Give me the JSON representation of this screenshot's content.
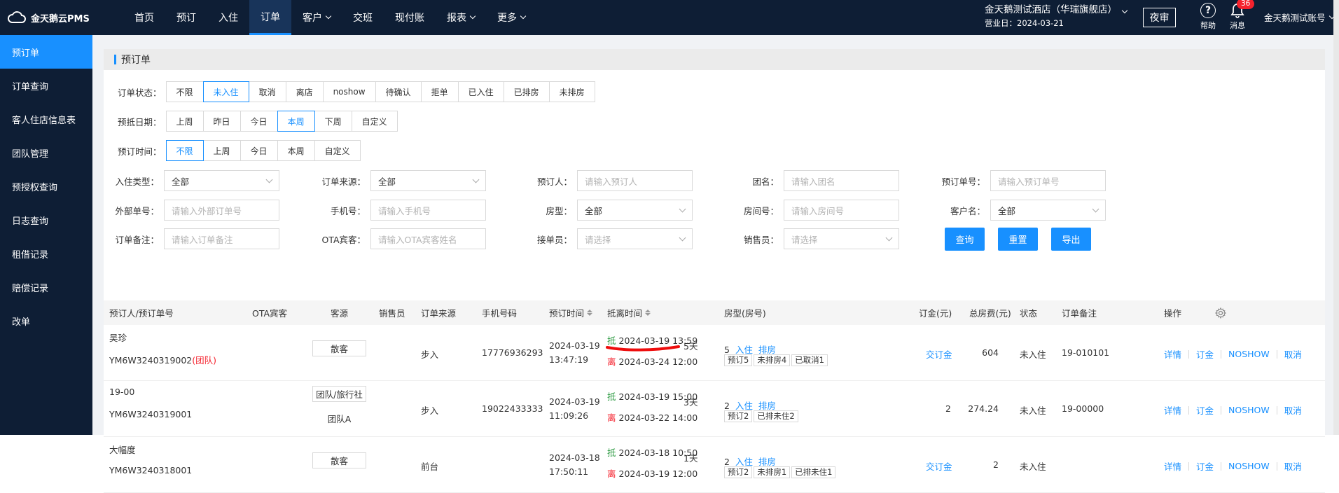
{
  "app": {
    "logo_text": "金天鹅云PMS"
  },
  "nav": [
    {
      "label": "首页",
      "caret": false
    },
    {
      "label": "预订",
      "caret": false
    },
    {
      "label": "入住",
      "caret": false
    },
    {
      "label": "订单",
      "caret": false,
      "active": true
    },
    {
      "label": "客户",
      "caret": true
    },
    {
      "label": "交班",
      "caret": false
    },
    {
      "label": "现付账",
      "caret": false
    },
    {
      "label": "报表",
      "caret": true
    },
    {
      "label": "更多",
      "caret": true
    }
  ],
  "header": {
    "hotel_name": "金天鹅测试酒店（华瑞旗舰店）",
    "business_date": "营业日：2024-03-21",
    "night_audit": "夜审",
    "help": "帮助",
    "message": "消息",
    "message_count": "36",
    "account": "金天鹅测试账号"
  },
  "sidebar": [
    {
      "label": "预订单",
      "active": true
    },
    {
      "label": "订单查询"
    },
    {
      "label": "客人住店信息表"
    },
    {
      "label": "团队管理"
    },
    {
      "label": "预授权查询"
    },
    {
      "label": "日志查询"
    },
    {
      "label": "租借记录"
    },
    {
      "label": "赔偿记录"
    },
    {
      "label": "改单"
    }
  ],
  "page_title": "预订单",
  "filters": {
    "status_label": "订单状态：",
    "status_options": [
      "不限",
      "未入住",
      "取消",
      "离店",
      "noshow",
      "待确认",
      "拒单",
      "已入住",
      "已排房",
      "未排房"
    ],
    "status_selected": 1,
    "arrive_label": "预抵日期：",
    "arrive_options": [
      "上周",
      "昨日",
      "今日",
      "本周",
      "下周",
      "自定义"
    ],
    "arrive_selected": 3,
    "book_label": "预订时间：",
    "book_options": [
      "不限",
      "上周",
      "今日",
      "本周",
      "自定义"
    ],
    "book_selected": 0,
    "fields": {
      "checkin_type": {
        "label": "入住类型：",
        "value": "全部"
      },
      "order_source": {
        "label": "订单来源：",
        "value": "全部"
      },
      "booker": {
        "label": "预订人：",
        "placeholder": "请输入预订人"
      },
      "group_name": {
        "label": "团名：",
        "placeholder": "请输入团名"
      },
      "order_no": {
        "label": "预订单号：",
        "placeholder": "请输入预订单号"
      },
      "ext_order_no": {
        "label": "外部单号：",
        "placeholder": "请输入外部订单号"
      },
      "phone": {
        "label": "手机号：",
        "placeholder": "请输入手机号"
      },
      "room_type": {
        "label": "房型：",
        "value": "全部"
      },
      "room_no": {
        "label": "房间号：",
        "placeholder": "请输入房间号"
      },
      "customer": {
        "label": "客户名：",
        "value": "全部"
      },
      "remark": {
        "label": "订单备注：",
        "placeholder": "请输入订单备注"
      },
      "ota_guest": {
        "label": "OTA宾客：",
        "placeholder": "请输入OTA宾客姓名"
      },
      "receiver": {
        "label": "接单员：",
        "placeholder": "请选择"
      },
      "sales": {
        "label": "销售员：",
        "placeholder": "请选择"
      }
    },
    "query": "查询",
    "reset": "重置",
    "export": "导出"
  },
  "table": {
    "headers": [
      "预订人/预订单号",
      "OTA宾客",
      "客源",
      "销售员",
      "订单来源",
      "手机号码",
      "预订时间",
      "抵离时间",
      "房型(房号)",
      "订金(元)",
      "总房费(元)",
      "状态",
      "订单备注",
      "操作"
    ],
    "rows": [
      {
        "booker": "吴珍",
        "order_no": "YM6W3240319002",
        "group_tag": "(团队)",
        "source_tag": "散客",
        "source_sub": "",
        "channel": "步入",
        "phone": "17776936293",
        "book_date": "2024-03-19",
        "book_time": "13:47:19",
        "arrive_mark": "抵",
        "arrive": "2024-03-19 13:59",
        "leave_mark": "离",
        "leave": "2024-03-24 12:00",
        "nights": "5天",
        "room_count": "5",
        "checkin_link": "入住",
        "assign_link": "排房",
        "room_tags": [
          "预订5",
          "未排房4",
          "已取消1"
        ],
        "deposit": "交订金",
        "deposit_is_link": true,
        "total": "604",
        "status": "未入住",
        "remark": "19-010101"
      },
      {
        "booker": "19-00",
        "order_no": "YM6W3240319001",
        "group_tag": "",
        "source_tag": "团队/旅行社",
        "source_sub": "团队A",
        "channel": "步入",
        "phone": "19022433333",
        "book_date": "2024-03-19",
        "book_time": "11:09:26",
        "arrive_mark": "抵",
        "arrive": "2024-03-19 15:00",
        "leave_mark": "离",
        "leave": "2024-03-22 14:00",
        "nights": "3天",
        "room_count": "2",
        "checkin_link": "入住",
        "assign_link": "排房",
        "room_tags": [
          "预订2",
          "已排未住2"
        ],
        "deposit": "2",
        "deposit_is_link": false,
        "total": "274.24",
        "status": "未入住",
        "remark": "19-00000"
      },
      {
        "booker": "大幅度",
        "order_no": "YM6W3240318001",
        "group_tag": "",
        "source_tag": "散客",
        "source_sub": "",
        "channel": "前台",
        "phone": "",
        "book_date": "2024-03-18",
        "book_time": "17:50:11",
        "arrive_mark": "抵",
        "arrive": "2024-03-18 10:50",
        "leave_mark": "离",
        "leave": "2024-03-19 12:00",
        "nights": "1天",
        "room_count": "2",
        "checkin_link": "入住",
        "assign_link": "排房",
        "room_tags": [
          "预订2",
          "未排房1",
          "已排未住1"
        ],
        "deposit": "交订金",
        "deposit_is_link": true,
        "total": "2",
        "status": "未入住",
        "remark": ""
      }
    ],
    "ops": [
      "详情",
      "订金",
      "NOSHOW",
      "取消"
    ]
  },
  "colors": {
    "brand": "#1890ff",
    "topbar": "#0e1e35",
    "danger": "#f5222d",
    "arrive": "#2e9b43"
  }
}
